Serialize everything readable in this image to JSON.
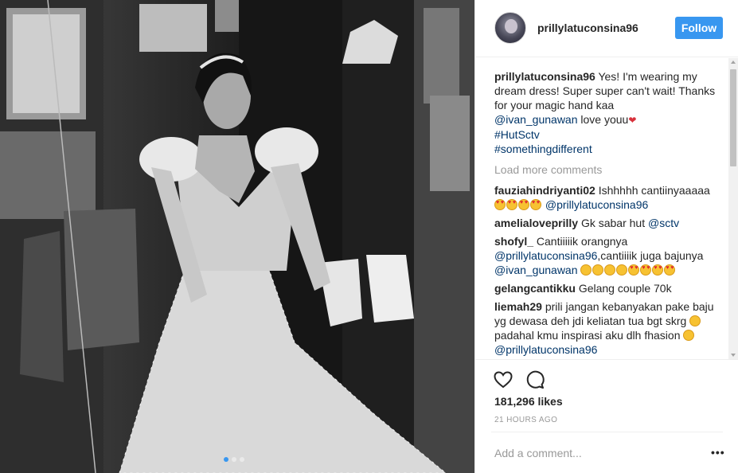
{
  "photo": {
    "description_icon": "post-photo",
    "carousel": {
      "count": 3,
      "active_index": 0
    }
  },
  "header": {
    "username": "prillylatuconsina96",
    "follow_label": "Follow"
  },
  "caption": {
    "username": "prillylatuconsina96",
    "text_1": "Yes! I'm wearing my dream dress! Super super can't wait! Thanks for your magic hand kaa",
    "mention": "@ivan_gunawan",
    "text_2": "love youu",
    "hashtag_1": "#HutSctv",
    "hashtag_2": "#somethingdifferent"
  },
  "load_more": "Load more comments",
  "comments": [
    {
      "username": "fauziahindriyanti02",
      "text": "Ishhhhh cantiinyaaaaa",
      "mention": "@prillylatuconsina96"
    },
    {
      "username": "amelialoveprilly",
      "text": "Gk sabar hut",
      "mention": "@sctv"
    },
    {
      "username": "shofyl_",
      "text": "Cantiiiiik orangnya",
      "mention_1": "@prillylatuconsina96",
      "text_2": ",cantiiiik juga bajunya",
      "mention_2": "@ivan_gunawan"
    },
    {
      "username": "gelangcantikku",
      "text": "Gelang couple 70k"
    },
    {
      "username": "liemah29",
      "text": "prili jangan kebanyakan pake baju yg dewasa deh jdi keliatan tua bgt skrg",
      "text_2": "padahal kmu inspirasi aku dlh fhasion",
      "mention": "@prillylatuconsina96"
    }
  ],
  "actions": {
    "like_icon": "heart-icon",
    "comment_icon": "comment-bubble-icon"
  },
  "likes": "181,296 likes",
  "time": "21 HOURS AGO",
  "add_comment": {
    "placeholder": "Add a comment...",
    "more_label": "•••"
  },
  "colors": {
    "accent": "#3897f0",
    "link": "#003569",
    "muted": "#999999",
    "text": "#262626"
  }
}
